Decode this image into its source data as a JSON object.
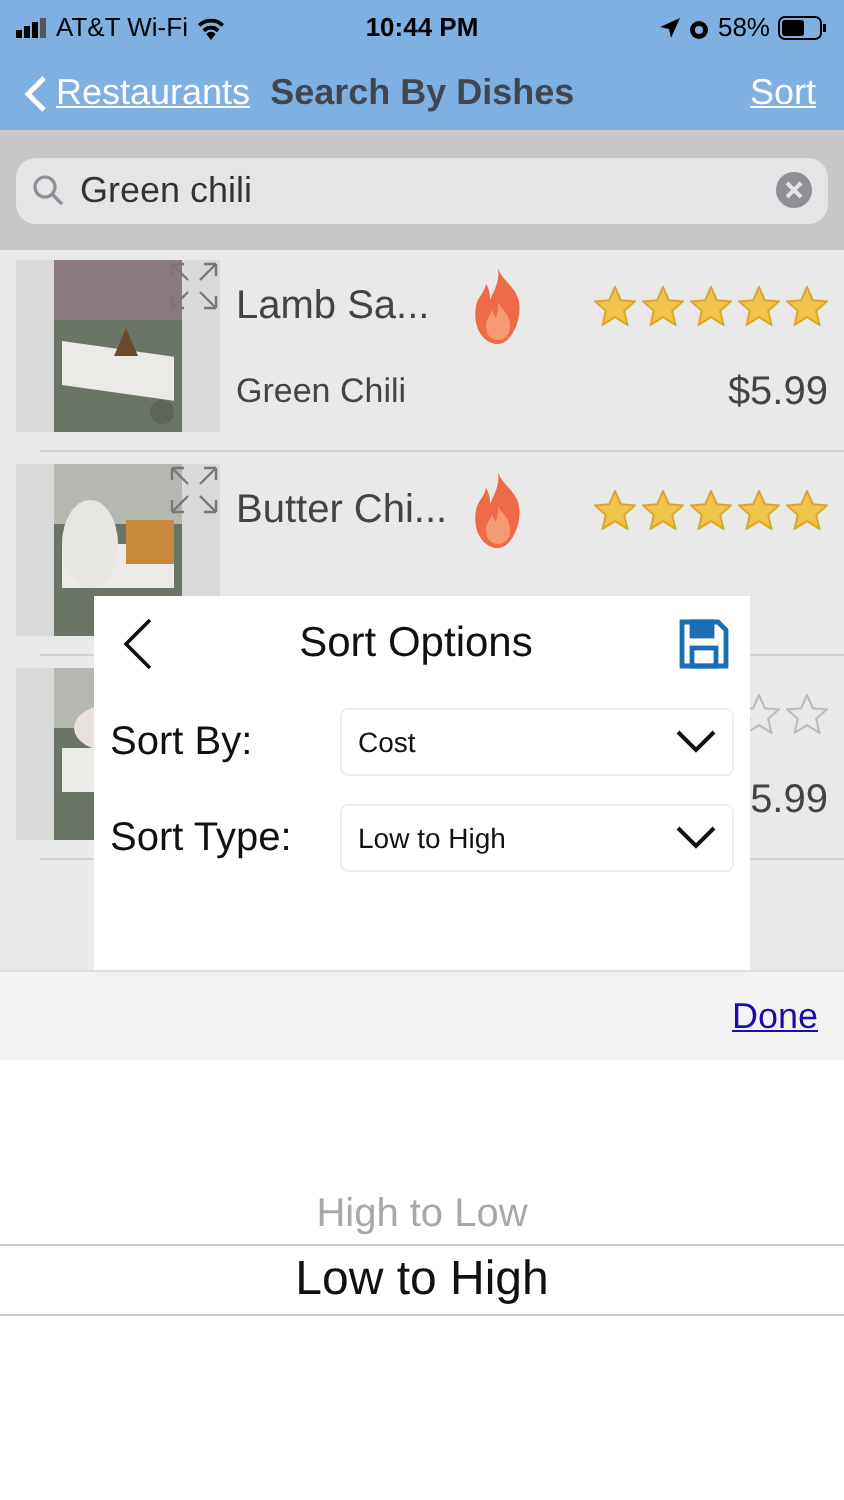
{
  "status_bar": {
    "carrier": "AT&T Wi-Fi",
    "time": "10:44 PM",
    "battery": "58%"
  },
  "nav": {
    "back": "Restaurants",
    "title": "Search By Dishes",
    "action": "Sort"
  },
  "search": {
    "value": "Green chili"
  },
  "dishes": [
    {
      "kind": "full",
      "name": "Lamb Sa...",
      "restaurant": "Green Chili",
      "price": "$5.99",
      "stars": 5
    },
    {
      "kind": "top",
      "name": "Butter Chi...",
      "stars": 5
    },
    {
      "kind": "covered",
      "price": "5.99"
    }
  ],
  "dialog": {
    "title": "Sort Options",
    "fields": [
      {
        "label": "Sort By:",
        "value": "Cost"
      },
      {
        "label": "Sort Type:",
        "value": "Low to High"
      }
    ]
  },
  "toolbar": {
    "done": "Done"
  },
  "picker": [
    {
      "label": "High to Low",
      "selected": false
    },
    {
      "label": "Low to High",
      "selected": true
    }
  ]
}
